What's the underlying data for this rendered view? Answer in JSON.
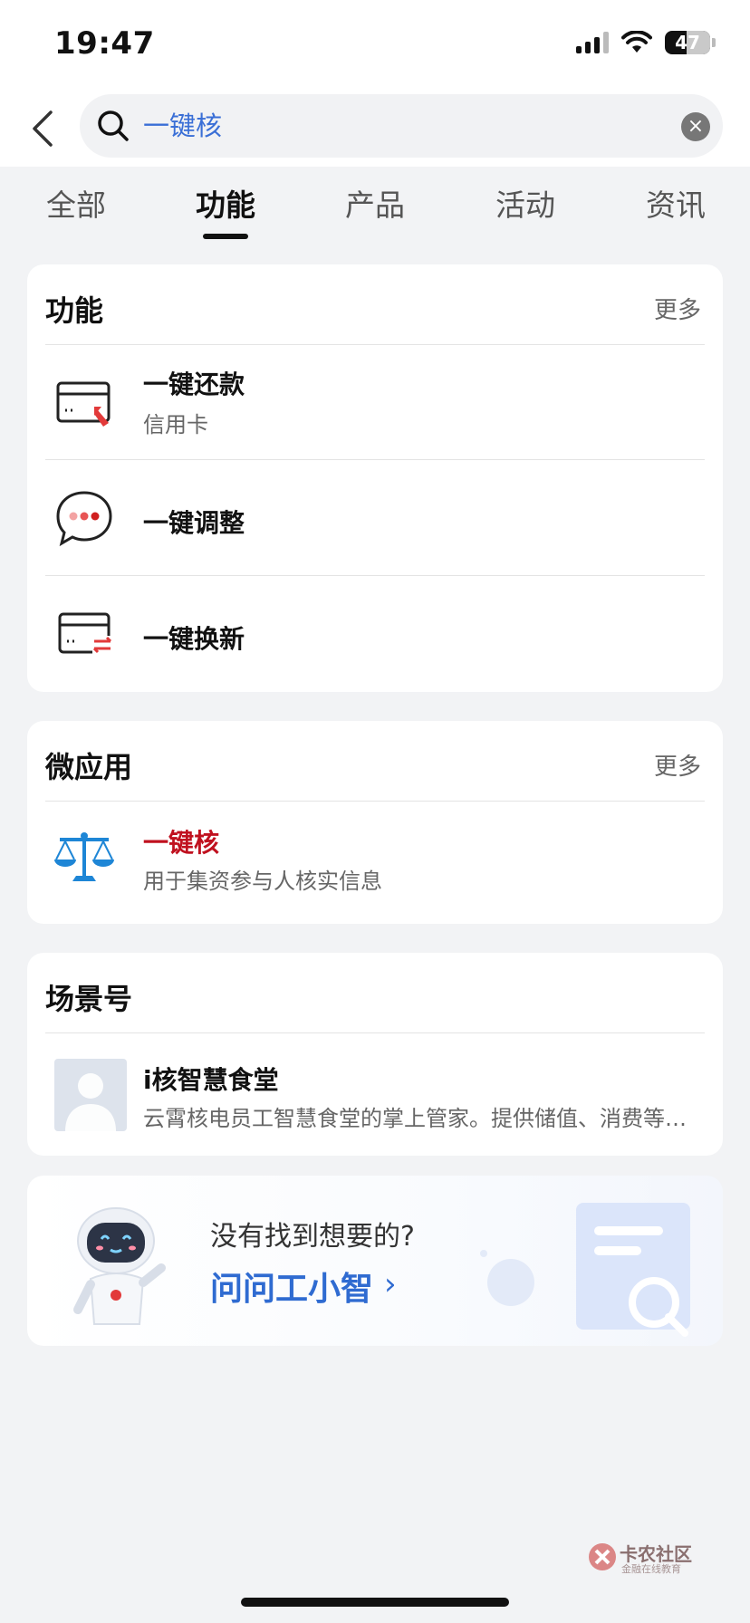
{
  "status_bar": {
    "time": "19:47",
    "battery": "47"
  },
  "search": {
    "query": "一键核"
  },
  "tabs": [
    {
      "label": "全部",
      "active": false
    },
    {
      "label": "功能",
      "active": true
    },
    {
      "label": "产品",
      "active": false
    },
    {
      "label": "活动",
      "active": false
    },
    {
      "label": "资讯",
      "active": false
    }
  ],
  "functions": {
    "title": "功能",
    "more": "更多",
    "items": [
      {
        "title": "一键还款",
        "subtitle": "信用卡",
        "icon": "card-repay-icon"
      },
      {
        "title": "一键调整",
        "icon": "chat-bubble-icon"
      },
      {
        "title": "一键换新",
        "icon": "card-exchange-icon"
      }
    ]
  },
  "mini_apps": {
    "title": "微应用",
    "more": "更多",
    "items": [
      {
        "title": "一键核",
        "subtitle": "用于集资参与人核实信息",
        "icon": "scales-icon",
        "title_color": "#c0111f"
      }
    ]
  },
  "scenes": {
    "title": "场景号",
    "items": [
      {
        "title": "i核智慧食堂",
        "subtitle": "云霄核电员工智慧食堂的掌上管家。提供储值、消费等…",
        "icon": "avatar-placeholder-icon"
      }
    ]
  },
  "ask": {
    "question": "没有找到想要的?",
    "link": "问问工小智",
    "chevron": "›"
  },
  "watermark": {
    "title": "卡农社区",
    "subtitle": "金融在线教育"
  },
  "colors": {
    "accent_blue": "#2f6bd1",
    "highlight_red": "#c0111f"
  }
}
